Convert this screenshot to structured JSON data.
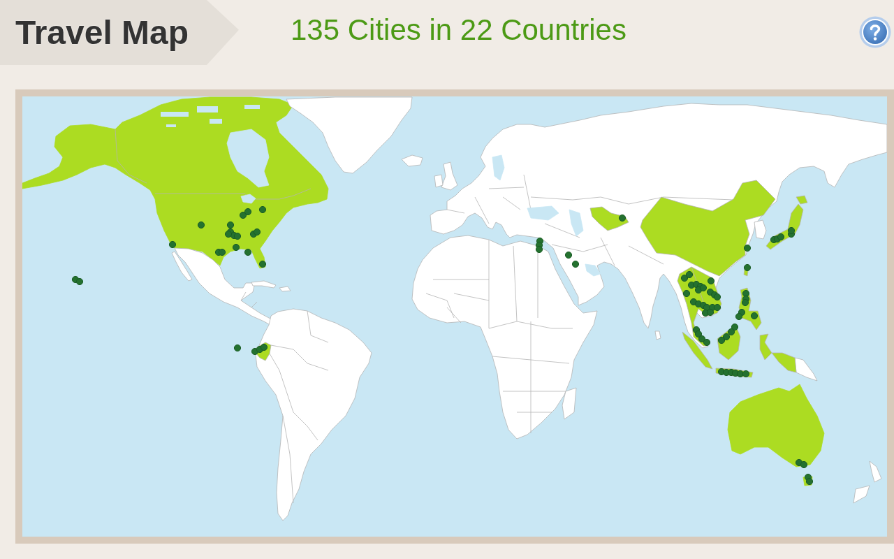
{
  "header": {
    "title": "Travel Map",
    "summary": "135 Cities in 22 Countries"
  }
}
